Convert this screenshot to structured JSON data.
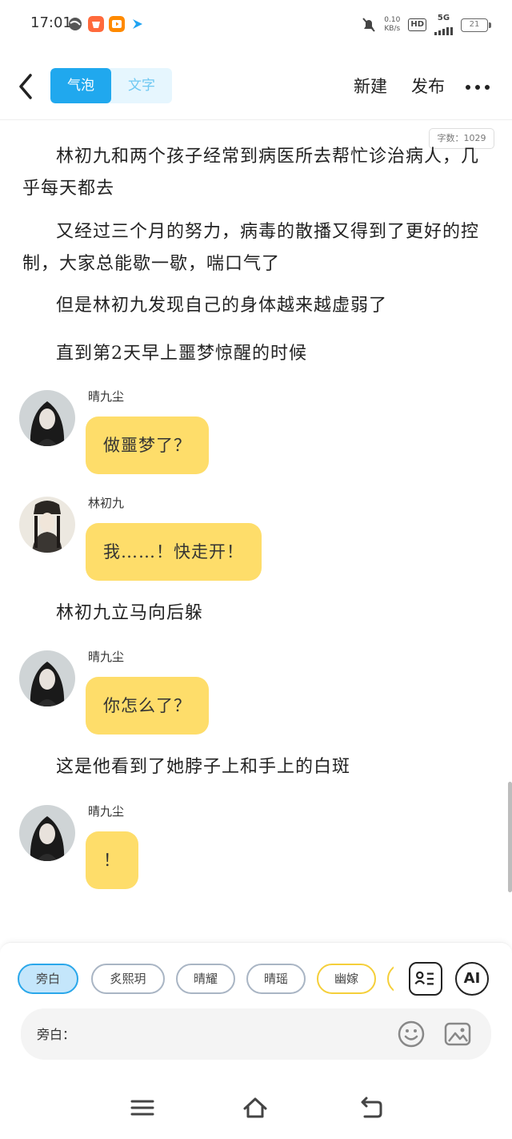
{
  "status_bar": {
    "time": "17:01",
    "net_speed_value": "0.10",
    "net_speed_unit": "KB/s",
    "hd": "HD",
    "network": "5G",
    "battery": "21"
  },
  "header": {
    "tabs": [
      {
        "label": "气泡",
        "active": true
      },
      {
        "label": "文字",
        "active": false
      }
    ],
    "new_label": "新建",
    "publish_label": "发布"
  },
  "word_count": "字数：1029",
  "content": {
    "paragraphs": [
      "林初九和两个孩子经常到病医所去帮忙诊治病人，几乎每天都去",
      "又经过三个月的努力，病毒的散播又得到了更好的控制，大家总能歇一歇，喘口气了",
      "但是林初九发现自己的身体越来越虚弱了",
      "直到第2天早上噩梦惊醒的时候"
    ],
    "messages": [
      {
        "speaker": "晴九尘",
        "text": "做噩梦了？"
      },
      {
        "speaker": "林初九",
        "text": "我……！快走开！"
      },
      {
        "speaker": "晴九尘",
        "text": "你怎么了？"
      },
      {
        "speaker": "晴九尘",
        "text": "！"
      }
    ],
    "narration_1": "林初九立马向后躲",
    "narration_2": "这是他看到了她脖子上和手上的白斑"
  },
  "roles": [
    {
      "label": "旁白",
      "selected": true
    },
    {
      "label": "炙熙玥",
      "selected": false
    },
    {
      "label": "晴耀",
      "selected": false
    },
    {
      "label": "晴瑶",
      "selected": false
    },
    {
      "label": "幽嫁",
      "selected": false
    }
  ],
  "tools": {
    "ai_label": "AI"
  },
  "input": {
    "placeholder": "旁白："
  },
  "colors": {
    "accent_blue": "#20a8ee",
    "bubble_yellow": "#fedd6a",
    "selected_chip": "#c4e6fb"
  }
}
